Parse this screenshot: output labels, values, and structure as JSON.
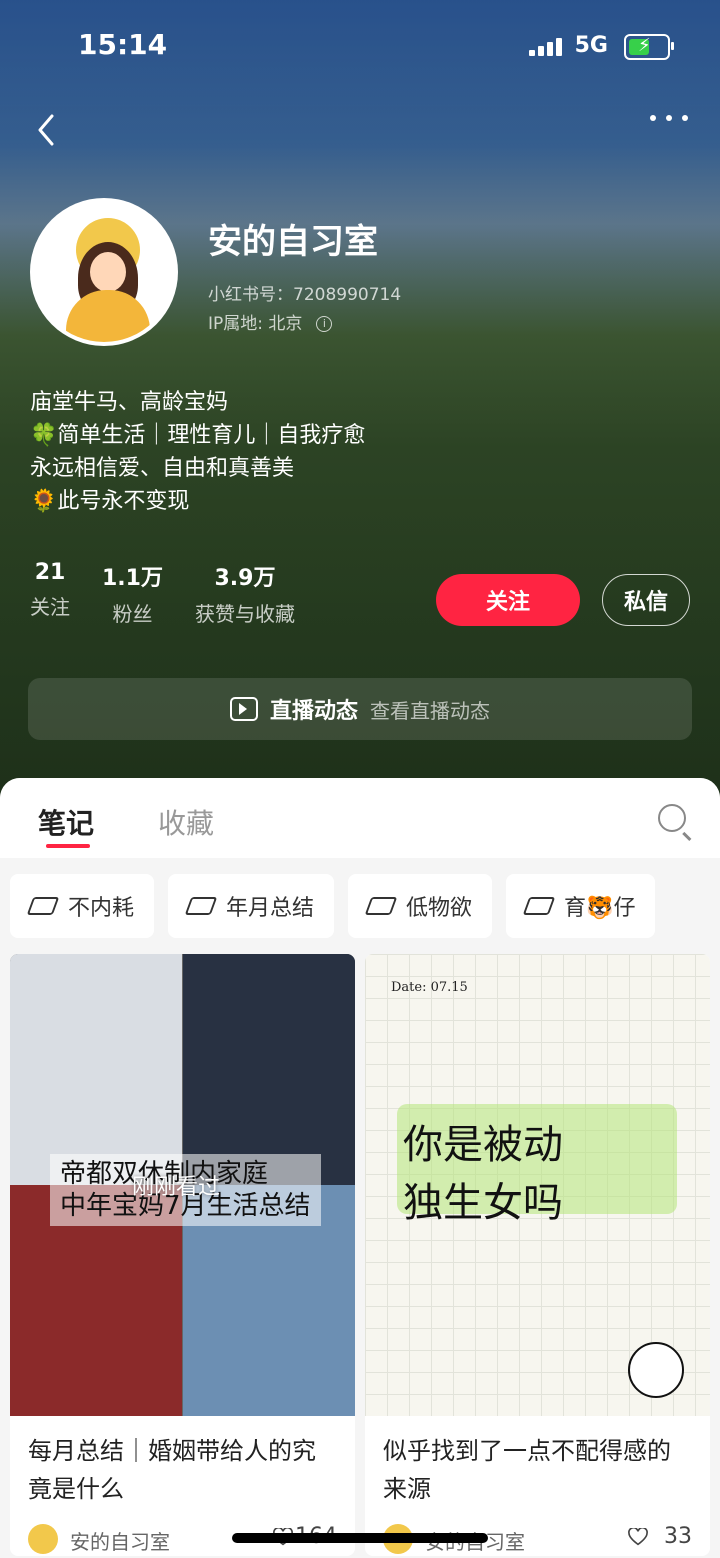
{
  "status_bar": {
    "time": "15:14",
    "network": "5G"
  },
  "profile": {
    "name": "安的自习室",
    "redbook_id": "小红书号：7208990714",
    "ip": "IP属地: 北京",
    "bio": [
      "庙堂牛马、高龄宝妈",
      "🍀简单生活｜理性育儿｜自我疗愈",
      "永远相信爱、自由和真善美",
      "🌻此号永不变现"
    ],
    "stats": [
      {
        "num": "21",
        "label": "关注"
      },
      {
        "num": "1.1万",
        "label": "粉丝"
      },
      {
        "num": "3.9万",
        "label": "获赞与收藏"
      }
    ],
    "follow_label": "关注",
    "message_label": "私信",
    "live": {
      "title": "直播动态",
      "subtitle": "查看直播动态"
    }
  },
  "tabs": {
    "active": "笔记",
    "inactive": "收藏"
  },
  "chips": [
    "不内耗",
    "年月总结",
    "低物欲",
    "育🐯仔"
  ],
  "cards": [
    {
      "overlay_line1": "帝都双休制内家庭",
      "overlay_line2": "中年宝妈7月生活总结",
      "seen_label": "刚刚看过",
      "title": "每月总结｜婚姻带给人的究竟是什么",
      "author": "安的自习室",
      "likes": "164"
    },
    {
      "date": "Date: 07.15",
      "hand_line1": "你是被动",
      "hand_line2": "独生女吗",
      "title": "似乎找到了一点不配得感的来源",
      "author": "安的自习室",
      "likes": "33"
    }
  ]
}
